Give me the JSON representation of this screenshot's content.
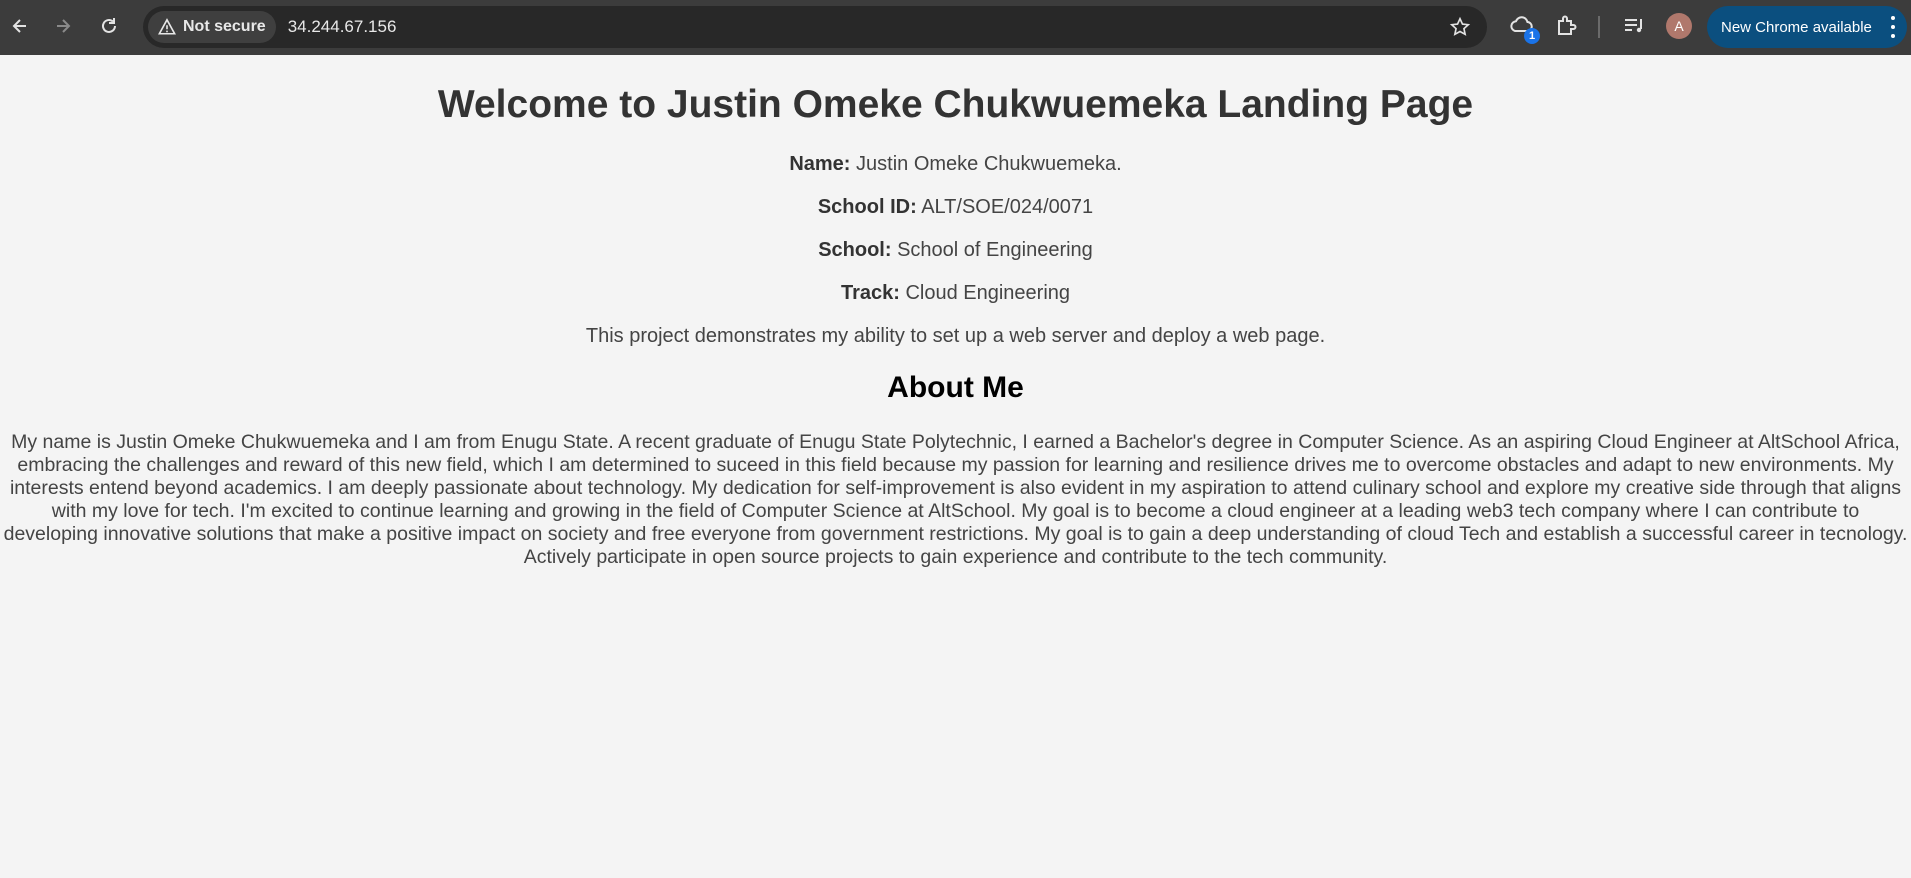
{
  "browser": {
    "security_label": "Not secure",
    "url": "34.244.67.156",
    "extension_badge": "1",
    "profile_initial": "A",
    "update_label": "New Chrome available"
  },
  "page": {
    "title": "Welcome to Justin Omeke Chukwuemeka Landing Page",
    "details": [
      {
        "label": "Name:",
        "value": "Justin Omeke Chukwuemeka."
      },
      {
        "label": "School ID:",
        "value": "ALT/SOE/024/0071"
      },
      {
        "label": "School:",
        "value": "School of Engineering"
      },
      {
        "label": "Track:",
        "value": "Cloud Engineering"
      }
    ],
    "project_statement": "This project demonstrates my ability to set up a web server and deploy a web page.",
    "about_heading": "About Me",
    "about_text": "My name is Justin Omeke Chukwuemeka and I am from Enugu State. A recent graduate of Enugu State Polytechnic, I earned a Bachelor's degree in Computer Science. As an aspiring Cloud Engineer at AltSchool Africa, embracing the challenges and reward of this new field, which I am determined to suceed in this field because my passion for learning and resilience drives me to overcome obstacles and adapt to new environments. My interests entend beyond academics. I am deeply passionate about technology. My dedication for self-improvement is also evident in my aspiration to attend culinary school and explore my creative side through that aligns with my love for tech. I'm excited to continue learning and growing in the field of Computer Science at AltSchool. My goal is to become a cloud engineer at a leading web3 tech company where I can contribute to developing innovative solutions that make a positive impact on society and free everyone from government restrictions. My goal is to gain a deep understanding of cloud Tech and establish a successful career in tecnology. Actively participate in open source projects to gain experience and contribute to the tech community."
  }
}
